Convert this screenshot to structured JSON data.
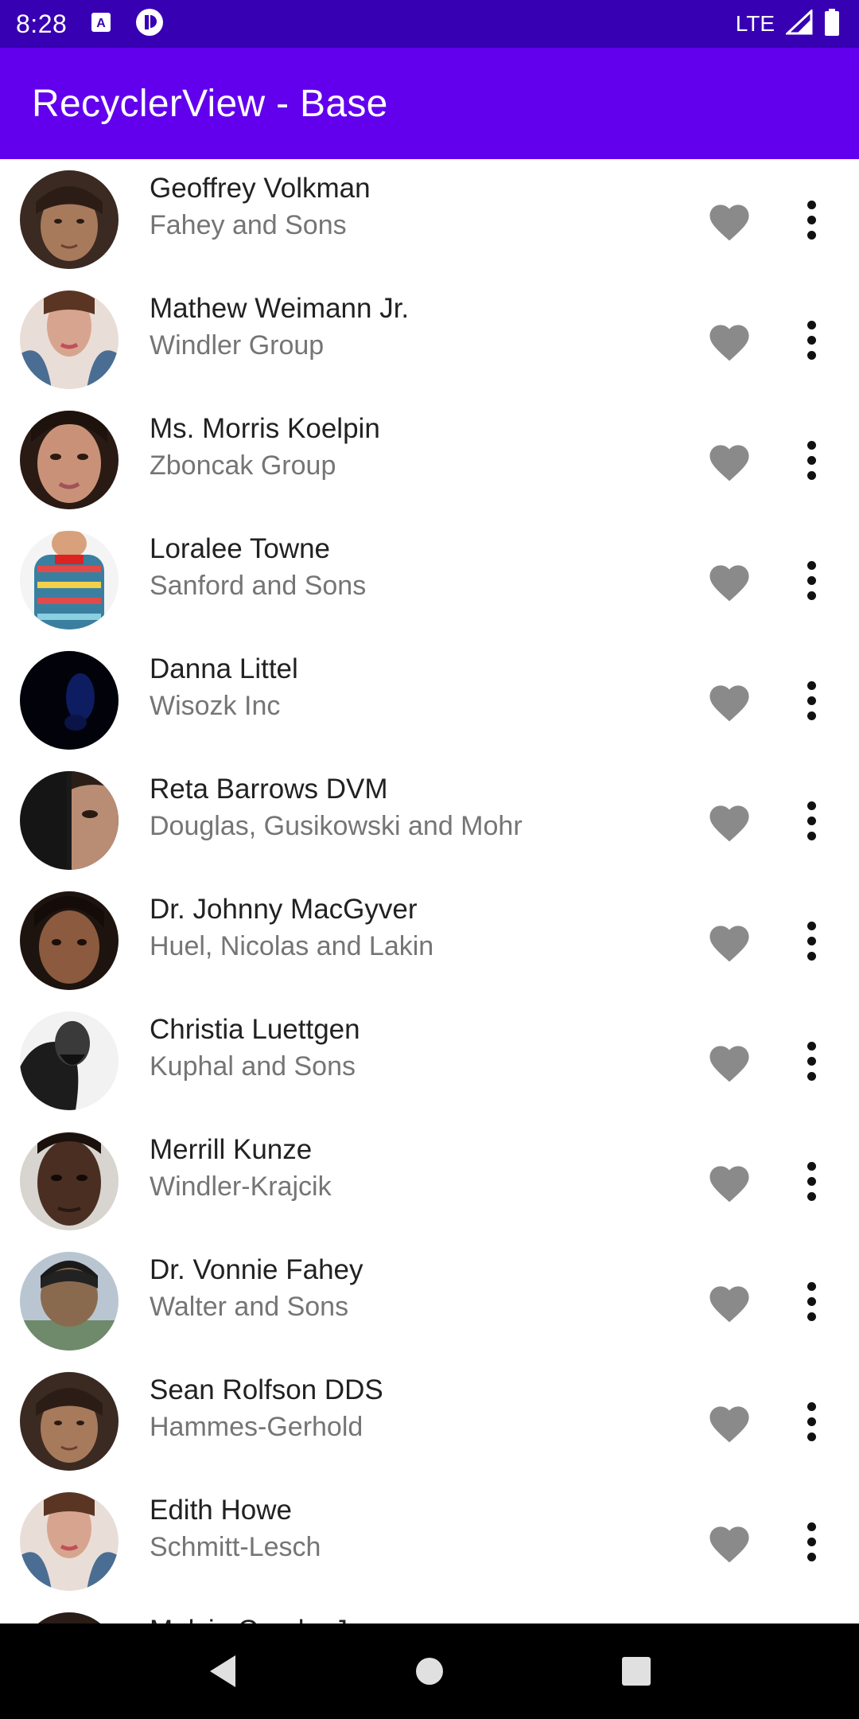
{
  "status_bar": {
    "time": "8:28",
    "network": "LTE",
    "icons": [
      "keyboard-a-icon",
      "data-saver-icon",
      "signal-icon",
      "battery-icon"
    ]
  },
  "app_bar": {
    "title": "RecyclerView - Base",
    "color": "#6200ee",
    "status_color": "#3700b3"
  },
  "list": {
    "items": [
      {
        "name": "Geoffrey Volkman",
        "company": "Fahey and Sons"
      },
      {
        "name": "Mathew Weimann Jr.",
        "company": "Windler Group"
      },
      {
        "name": "Ms. Morris Koelpin",
        "company": "Zboncak Group"
      },
      {
        "name": "Loralee Towne",
        "company": "Sanford and Sons"
      },
      {
        "name": "Danna Littel",
        "company": "Wisozk Inc"
      },
      {
        "name": "Reta Barrows DVM",
        "company": "Douglas, Gusikowski and Mohr"
      },
      {
        "name": "Dr. Johnny MacGyver",
        "company": "Huel, Nicolas and Lakin"
      },
      {
        "name": "Christia Luettgen",
        "company": "Kuphal and Sons"
      },
      {
        "name": "Merrill Kunze",
        "company": "Windler-Krajcik"
      },
      {
        "name": "Dr. Vonnie Fahey",
        "company": "Walter and Sons"
      },
      {
        "name": "Sean Rolfson DDS",
        "company": "Hammes-Gerhold"
      },
      {
        "name": "Edith Howe",
        "company": "Schmitt-Lesch"
      },
      {
        "name": "Melvin Crooks Jr.",
        "company": ""
      }
    ],
    "row_icons": [
      "heart-icon",
      "more-vert-icon"
    ],
    "heart_color": "#8a8a8a"
  },
  "nav_bar": {
    "icons": [
      "back-icon",
      "home-icon",
      "recents-icon"
    ]
  }
}
